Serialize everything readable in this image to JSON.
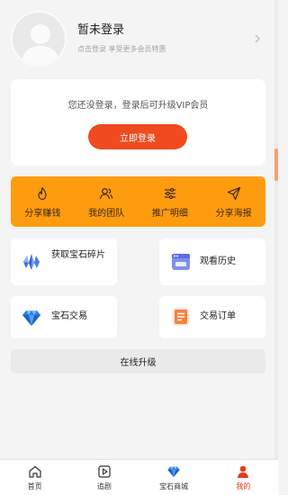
{
  "profile": {
    "name": "暂未登录",
    "subtitle": "点击登录 享受更多会员特惠"
  },
  "login_card": {
    "tip": "您还没登录，登录后可升级VIP会员",
    "button": "立即登录"
  },
  "menu": {
    "items": [
      {
        "label": "分享赚钱",
        "icon": "flame-icon"
      },
      {
        "label": "我的团队",
        "icon": "team-icon"
      },
      {
        "label": "推广明细",
        "icon": "sliders-icon"
      },
      {
        "label": "分享海报",
        "icon": "send-icon"
      }
    ]
  },
  "features": {
    "gem_fragments": "获取宝石碎片",
    "watch_history": "观看历史",
    "gem_trade": "宝石交易",
    "trade_orders": "交易订单"
  },
  "upgrade": "在线升级",
  "tabbar": {
    "items": [
      {
        "label": "首页",
        "icon": "home-icon"
      },
      {
        "label": "追剧",
        "icon": "play-icon"
      },
      {
        "label": "宝石商城",
        "icon": "diamond-icon"
      },
      {
        "label": "我的",
        "icon": "person-icon"
      }
    ],
    "active": "我的"
  },
  "colors": {
    "accent": "#f04a1f",
    "menu_bg": "#ff9b0f",
    "active_tab": "#e83a18"
  }
}
